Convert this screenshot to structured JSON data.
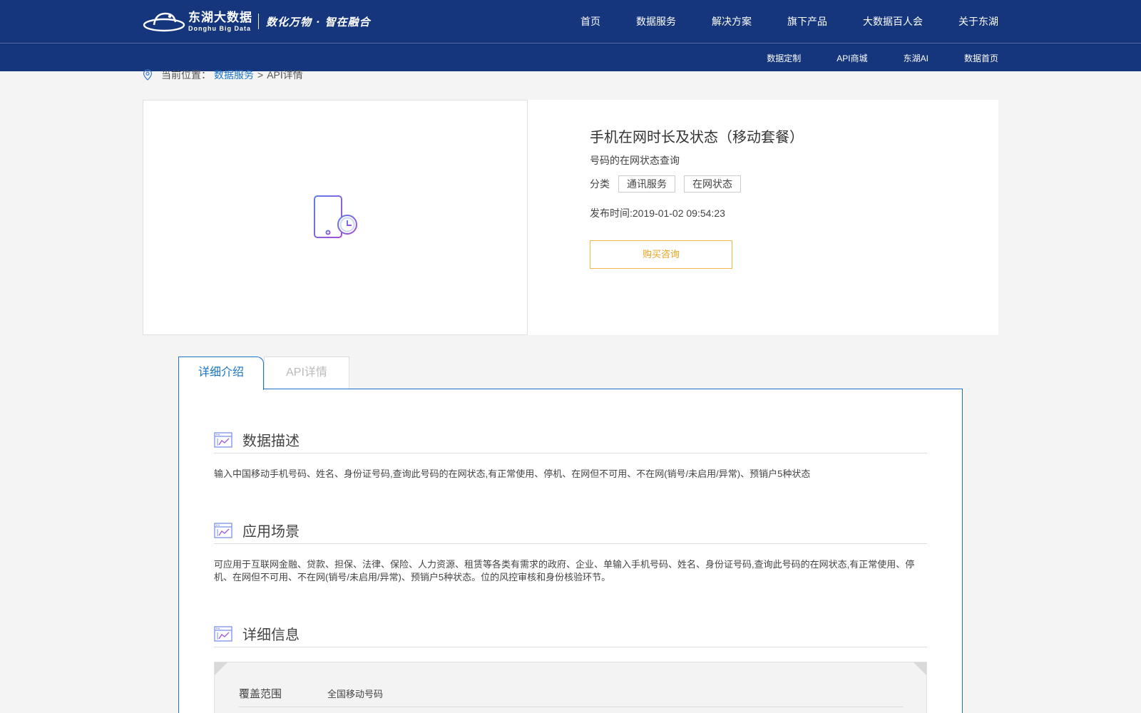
{
  "brand": {
    "name_cn": "东湖大数据",
    "name_en": "Donghu Big Data",
    "slogan": "数化万物 · 智在融合"
  },
  "main_nav": [
    "首页",
    "数据服务",
    "解决方案",
    "旗下产品",
    "大数据百人会",
    "关于东湖"
  ],
  "sub_nav": [
    "数据定制",
    "API商城",
    "东湖AI",
    "数据首页"
  ],
  "breadcrumb": {
    "prefix": "当前位置：",
    "link": "数据服务",
    "separator": ">",
    "current": "API详情"
  },
  "product": {
    "title": "手机在网时长及状态（移动套餐）",
    "description": "号码的在网状态查询",
    "category_label": "分类",
    "tags": [
      "通讯服务",
      "在网状态"
    ],
    "publish_time": "发布时间:2019-01-02 09:54:23",
    "buy_button": "购买咨询",
    "image_icon": "phone-clock-icon"
  },
  "tabs": [
    {
      "label": "详细介绍",
      "active": true
    },
    {
      "label": "API详情",
      "active": false
    }
  ],
  "sections": [
    {
      "title": "数据描述",
      "icon": "chart-window-icon",
      "body": "输入中国移动手机号码、姓名、身份证号码,查询此号码的在网状态,有正常使用、停机、在网但不可用、不在网(销号/未启用/异常)、预销户5种状态"
    },
    {
      "title": "应用场景",
      "icon": "chart-window-icon",
      "body": "可应用于互联网金融、贷款、担保、法律、保险、人力资源、租赁等各类有需求的政府、企业、单输入手机号码、姓名、身份证号码,查询此号码的在网状态,有正常使用、停机、在网但不可用、不在网(销号/未启用/异常)、预销户5种状态。位的风控审核和身份核验环节。"
    },
    {
      "title": "详细信息",
      "icon": "chart-window-icon",
      "body": ""
    }
  ],
  "detail_table": [
    {
      "key": "覆盖范围",
      "value": "全国移动号码"
    }
  ],
  "colors": {
    "nav_bg": "#15367c",
    "accent_blue": "#1a73c9",
    "buy_orange": "#e7a21c",
    "icon_purple": "#7b5ce6"
  }
}
